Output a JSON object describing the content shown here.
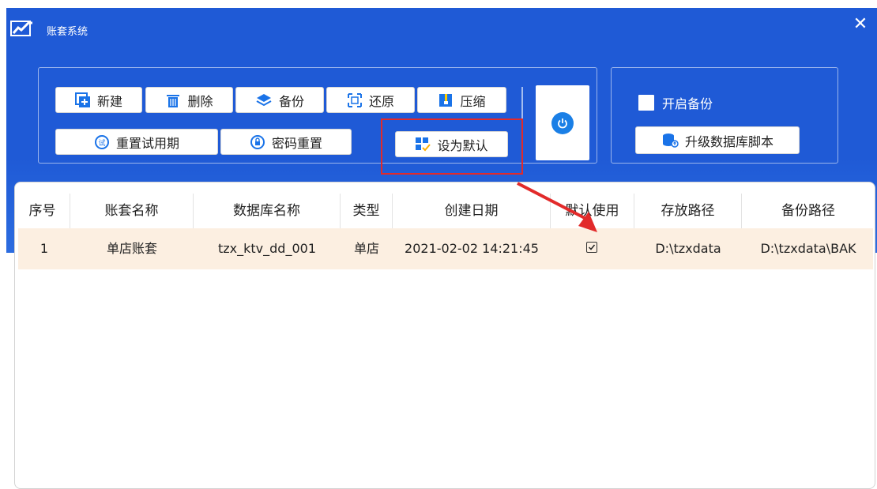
{
  "window": {
    "title": "账套系统",
    "close_glyph": "✕"
  },
  "toolbar": {
    "new_label": "新建",
    "delete_label": "删除",
    "backup_label": "备份",
    "restore_label": "还原",
    "compress_label": "压缩",
    "reset_trial_label": "重置试用期",
    "reset_password_label": "密码重置",
    "set_default_label": "设为默认"
  },
  "right_panel": {
    "enable_backup_label": "开启备份",
    "enable_backup_checked": false,
    "upgrade_script_label": "升级数据库脚本"
  },
  "table": {
    "columns": [
      "序号",
      "账套名称",
      "数据库名称",
      "类型",
      "创建日期",
      "默认使用",
      "存放路径",
      "备份路径"
    ],
    "rows": [
      {
        "index": "1",
        "name": "单店账套",
        "db_name": "tzx_ktv_dd_001",
        "type": "单店",
        "created": "2021-02-02 14:21:45",
        "default": true,
        "path": "D:\\tzxdata",
        "backup_path": "D:\\tzxdata\\BAK"
      }
    ]
  },
  "colors": {
    "header_blue": "#1f5ad6",
    "row_highlight": "#fcefe1",
    "annotation_red": "#e22a2a",
    "power_blue": "#1a7fe6"
  },
  "icons": {
    "app": "chart-logo-icon",
    "new": "plus-box-icon",
    "delete": "trash-icon",
    "backup": "layers-icon",
    "restore": "restore-frame-icon",
    "compress": "archive-icon",
    "reset_trial": "trial-badge-icon",
    "reset_password": "lock-circle-icon",
    "set_default": "grid-check-icon",
    "power": "power-icon",
    "upgrade": "database-upgrade-icon"
  }
}
